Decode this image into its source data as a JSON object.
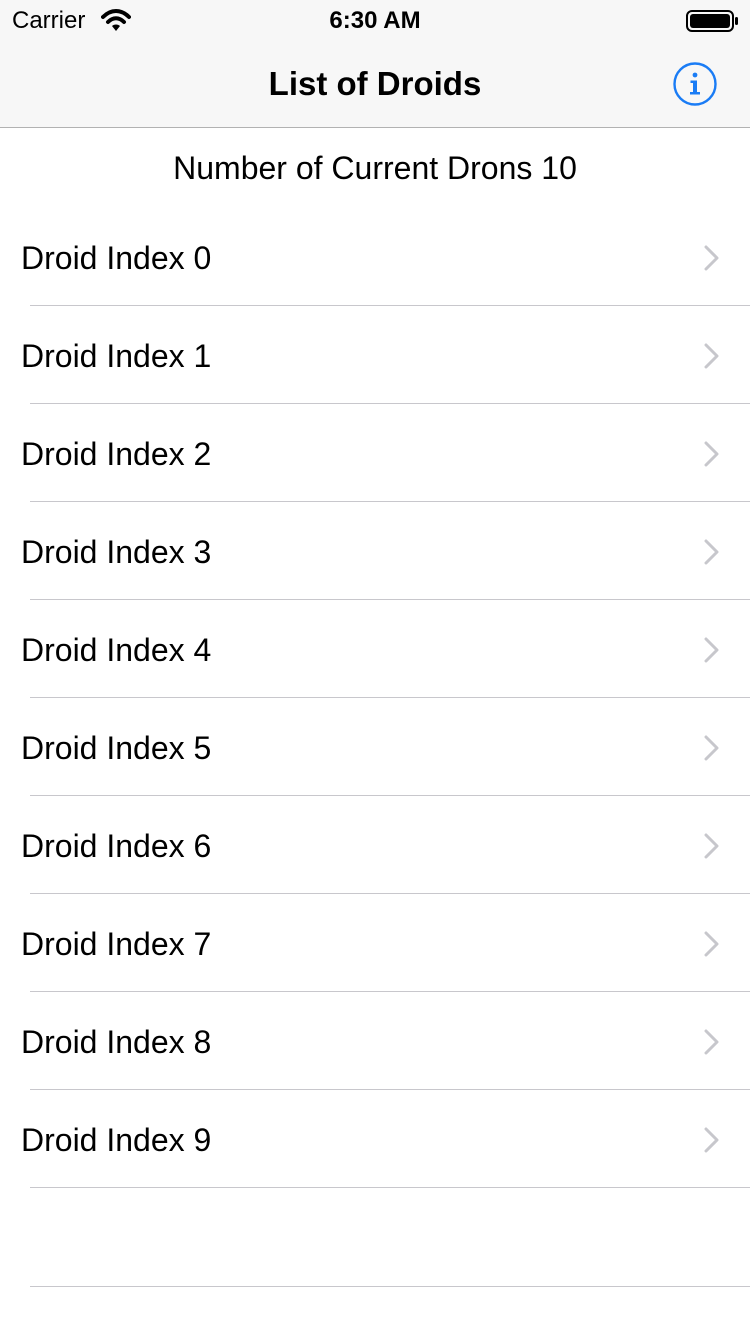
{
  "status_bar": {
    "carrier": "Carrier",
    "time": "6:30 AM",
    "wifi_icon": "wifi-icon",
    "battery_icon": "battery-icon"
  },
  "nav": {
    "title": "List of Droids",
    "info_icon": "info-icon",
    "accent_color": "#1a7cf5"
  },
  "list": {
    "header": "Number of Current Drons 10",
    "chevron_icon": "chevron-right-icon",
    "items": [
      {
        "label": "Droid Index 0"
      },
      {
        "label": "Droid Index 1"
      },
      {
        "label": "Droid Index 2"
      },
      {
        "label": "Droid Index 3"
      },
      {
        "label": "Droid Index 4"
      },
      {
        "label": "Droid Index 5"
      },
      {
        "label": "Droid Index 6"
      },
      {
        "label": "Droid Index 7"
      },
      {
        "label": "Droid Index 8"
      },
      {
        "label": "Droid Index 9"
      }
    ]
  }
}
